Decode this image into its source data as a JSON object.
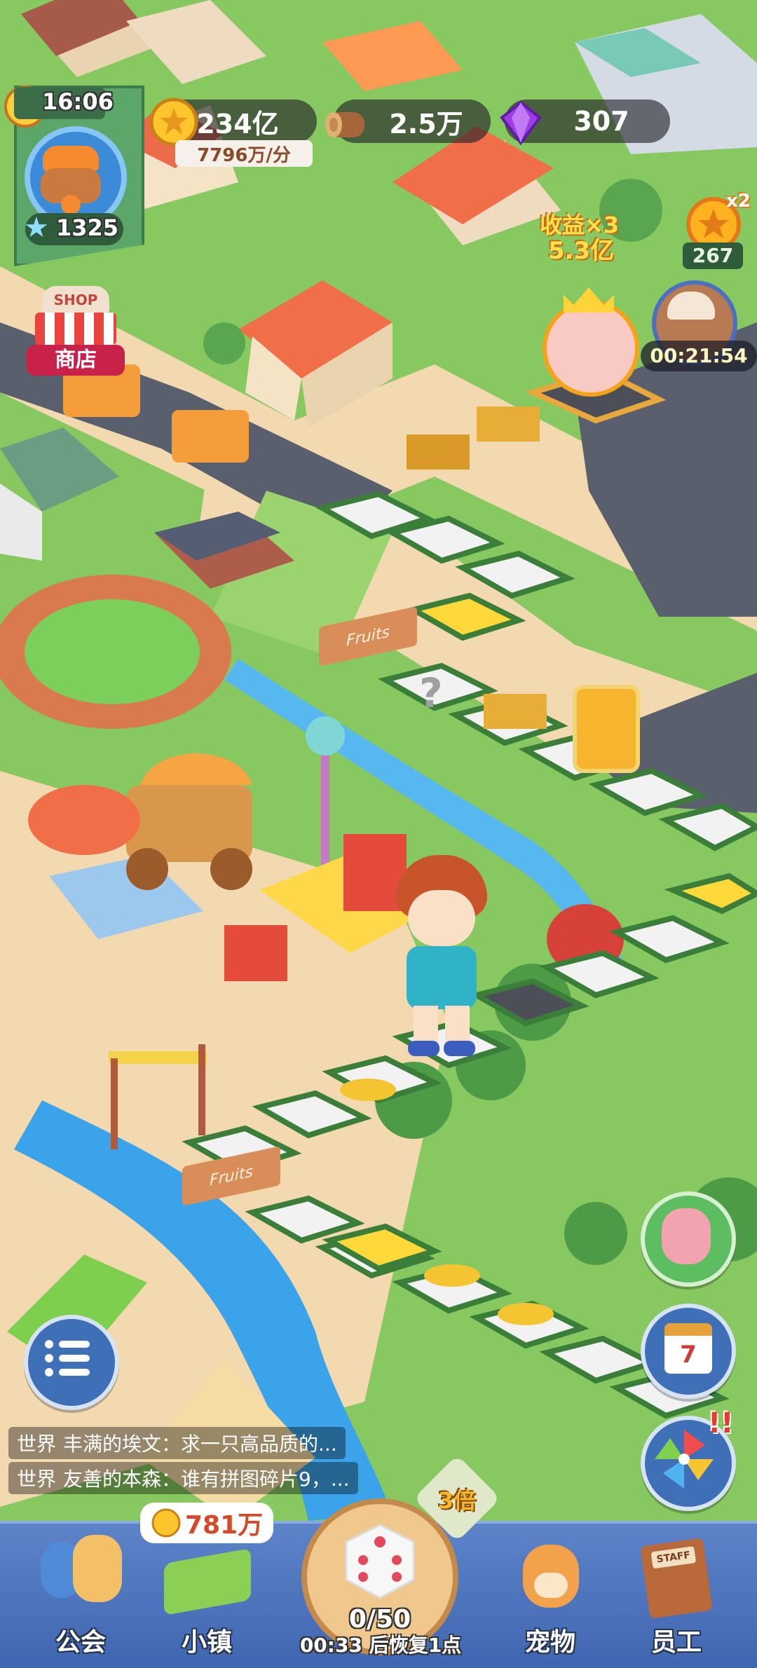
{
  "hud": {
    "time": "16:06",
    "level": "1325",
    "coins": "234亿",
    "coins_rate": "7796万/分",
    "wood": "2.5万",
    "gems": "307"
  },
  "shop": {
    "sign": "SHOP",
    "label": "商店"
  },
  "bonus": {
    "earnings_label": "收益×3",
    "earnings_value": "5.3亿",
    "coin_multiplier": "x2",
    "coin_count": "267",
    "timer": "00:21:54"
  },
  "board": {
    "fruits_label": "Fruits",
    "mystery_symbol": "?"
  },
  "chat": [
    {
      "channel": "世界",
      "text": "丰满的埃文：求一只高品质的..."
    },
    {
      "channel": "世界",
      "text": "友善的本森：谁有拼图碎片9，..."
    }
  ],
  "bottom": {
    "town_coins": "781万",
    "multiplier": "3倍",
    "dice_count": "0/50",
    "dice_recover": "00:33 后恢复1点",
    "nav": {
      "guild": "公会",
      "town": "小镇",
      "pet": "宠物",
      "staff": "员工"
    },
    "staff_book_label": "STAFF"
  },
  "side": {
    "calendar_day": "7",
    "alert": "!!"
  }
}
